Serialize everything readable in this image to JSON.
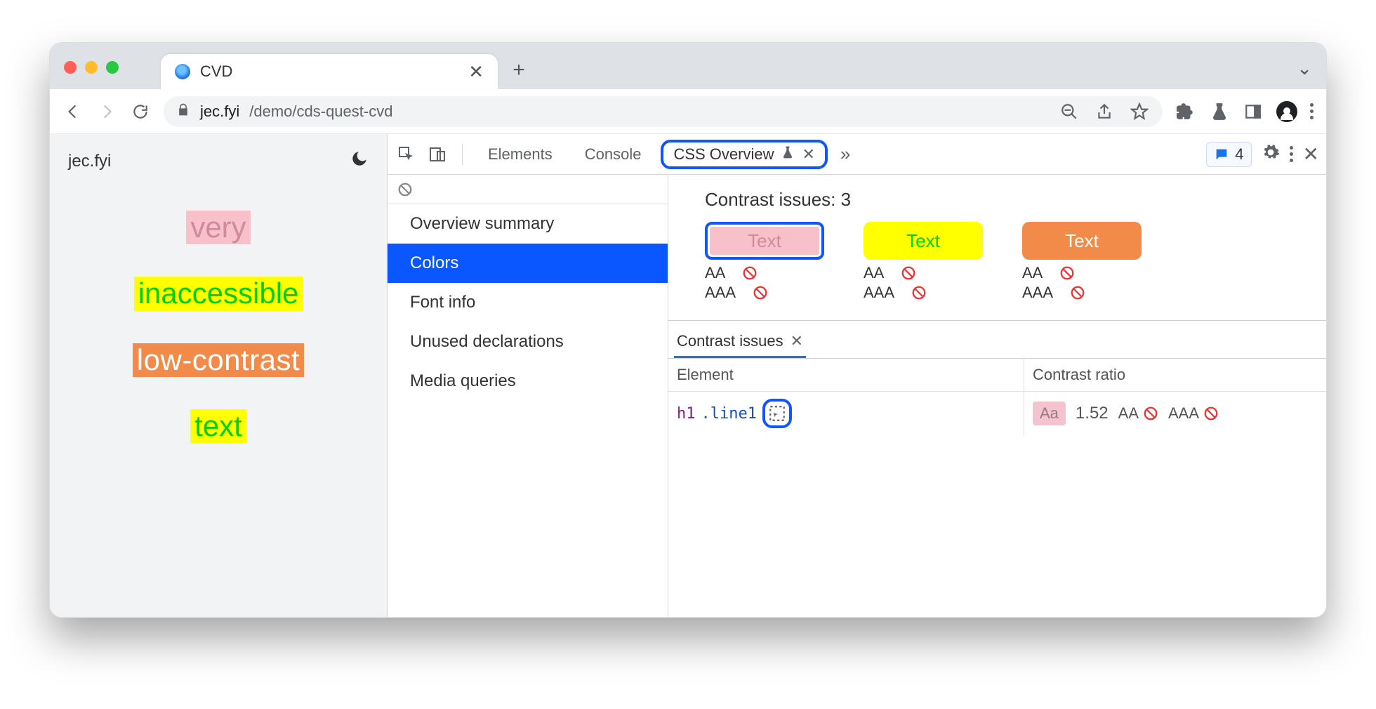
{
  "browser": {
    "tab_title": "CVD",
    "url_domain": "jec.fyi",
    "url_path": "/demo/cds-quest-cvd"
  },
  "page": {
    "site_label": "jec.fyi",
    "samples": {
      "very": "very",
      "inaccessible": "inaccessible",
      "low_contrast": "low-contrast",
      "text": "text"
    }
  },
  "devtools": {
    "tabs": {
      "elements": "Elements",
      "console": "Console",
      "css_overview": "CSS Overview"
    },
    "issues_count": "4",
    "side_nav": {
      "overview": "Overview summary",
      "colors": "Colors",
      "font_info": "Font info",
      "unused": "Unused declarations",
      "media": "Media queries"
    },
    "contrast": {
      "heading": "Contrast issues: 3",
      "swatches": {
        "text_label": "Text",
        "aa": "AA",
        "aaa": "AAA"
      },
      "panel_tab": "Contrast issues",
      "columns": {
        "element": "Element",
        "ratio": "Contrast ratio"
      },
      "row": {
        "tag": "h1",
        "class": ".line1",
        "aa_chip": "Aa",
        "ratio": "1.52",
        "aa_label": "AA",
        "aaa_label": "AAA"
      }
    }
  }
}
